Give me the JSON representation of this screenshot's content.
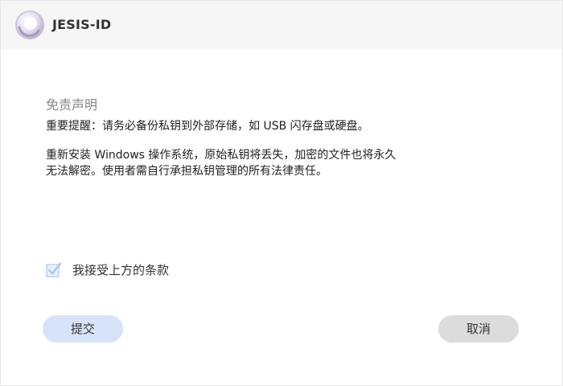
{
  "app": {
    "title": "JESIS-ID"
  },
  "disclaimer": {
    "heading": "免责声明",
    "notice": "重要提醒：请务必备份私钥到外部存储，如 USB 闪存盘或硬盘。",
    "paragraph_lines": [
      "重新安装 Windows 操作系统，原始私钥将丢失，加密的文件也将永久",
      "无法解密。使用者需自行承担私钥管理的所有法律责任。"
    ]
  },
  "agreement": {
    "label": "我接受上方的条款",
    "checked": true
  },
  "buttons": {
    "submit_label": "提交",
    "cancel_label": "取消"
  },
  "colors": {
    "titlebar_bg": "#f6f6f6",
    "submit_bg": "#d7e3f8",
    "cancel_bg": "#dcdcdc",
    "checkbox_color": "#aec9ea"
  },
  "icons": {
    "logo": "app-logo-icon",
    "checkbox": "checkmark-icon"
  }
}
